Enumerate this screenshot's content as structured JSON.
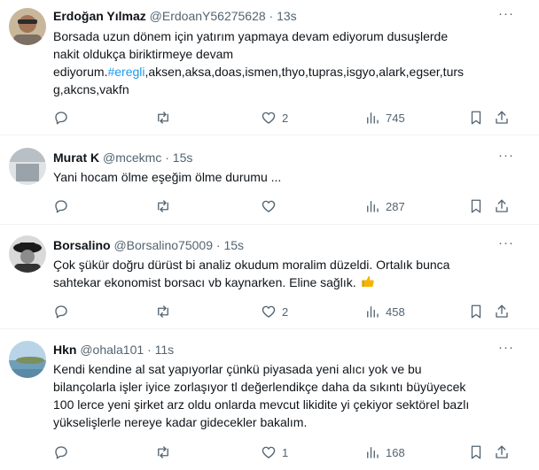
{
  "tweets": [
    {
      "name": "Erdoğan Yılmaz",
      "handle": "@ErdoanY56275628",
      "separator": "·",
      "time": "13s",
      "text_line1": "Borsada uzun dönem için yatırım yapmaya devam ediyorum dusuşlerde",
      "text_line2": "nakit oldukça biriktirmeye devam",
      "text_line3_plain": "ediyorum.",
      "text_line3_tag": "#eregli",
      "text_line3_rest": ",aksen,aksa,doas,ismen,thyo,tupras,isgyo,alark,egser,turs",
      "text_line4": "g,akcns,vakfn",
      "reply_count": "",
      "retweet_count": "",
      "like_count": "2",
      "view_count": "745"
    },
    {
      "name": "Murat K",
      "handle": "@mcekmc",
      "separator": "·",
      "time": "15s",
      "text_line1": "Yani hocam ölme eşeğim ölme durumu ...",
      "reply_count": "",
      "retweet_count": "",
      "like_count": "",
      "view_count": "287"
    },
    {
      "name": "Borsalino",
      "handle": "@Borsalino75009",
      "separator": "·",
      "time": "15s",
      "text_line1": "Çok şükür doğru dürüst bi analiz okudum moralim düzeldi. Ortalık bunca",
      "text_line2": "sahtekar ekonomist borsacı vb kaynarken. Eline sağlık.",
      "emoji": "thumbs-up-emoji",
      "reply_count": "",
      "retweet_count": "",
      "like_count": "2",
      "view_count": "458"
    },
    {
      "name": "Hkn",
      "handle": "@ohala101",
      "separator": "·",
      "time": "11s",
      "text_line1": "Kendi kendine al sat yapıyorlar çünkü piyasada yeni alıcı yok ve bu",
      "text_line2": "bilançolarla işler iyice zorlaşıyor tl değerlendikçe daha da sıkıntı büyüyecek",
      "text_line3": "100 lerce yeni şirket arz oldu onlarda mevcut likidite yi çekiyor sektörel bazlı",
      "text_line4": "yükselişlerle nereye kadar gidecekler bakalım.",
      "reply_count": "",
      "retweet_count": "",
      "like_count": "1",
      "view_count": "168"
    }
  ],
  "icons": {
    "reply": "reply-icon",
    "retweet": "retweet-icon",
    "like": "heart-icon",
    "views": "views-icon",
    "bookmark": "bookmark-icon",
    "share": "share-icon",
    "more": "more-icon"
  },
  "colors": {
    "text": "#0f1419",
    "secondary": "#536471",
    "link": "#1d9bf0",
    "divider": "#eff3f4"
  }
}
